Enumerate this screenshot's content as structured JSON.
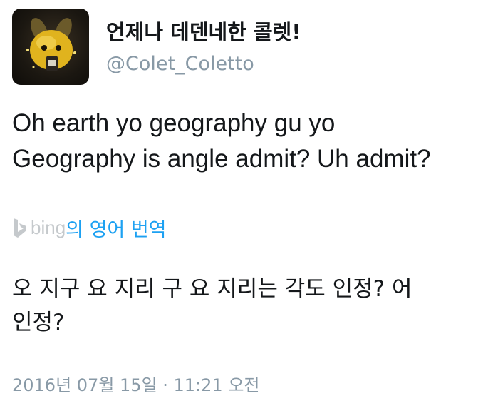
{
  "profile": {
    "display_name": "언제나 데덴네한 콜렛!",
    "handle": "@Colet_Coletto",
    "avatar_icon": "dedenne-avatar"
  },
  "tweet": {
    "lines": [
      "Oh earth yo geography gu yo",
      "Geography is angle admit? Uh admit?"
    ]
  },
  "translation": {
    "provider_icon": "bing-logo-icon",
    "provider": "bing",
    "label": "의 영어 번역",
    "lines": [
      "오 지구 요 지리 구 요 지리는 각도 인정? 어",
      "인정?"
    ],
    "link_color": "#1da1f2"
  },
  "meta": {
    "timestamp": "2016년 07월 15일 · 11:21 오전"
  }
}
